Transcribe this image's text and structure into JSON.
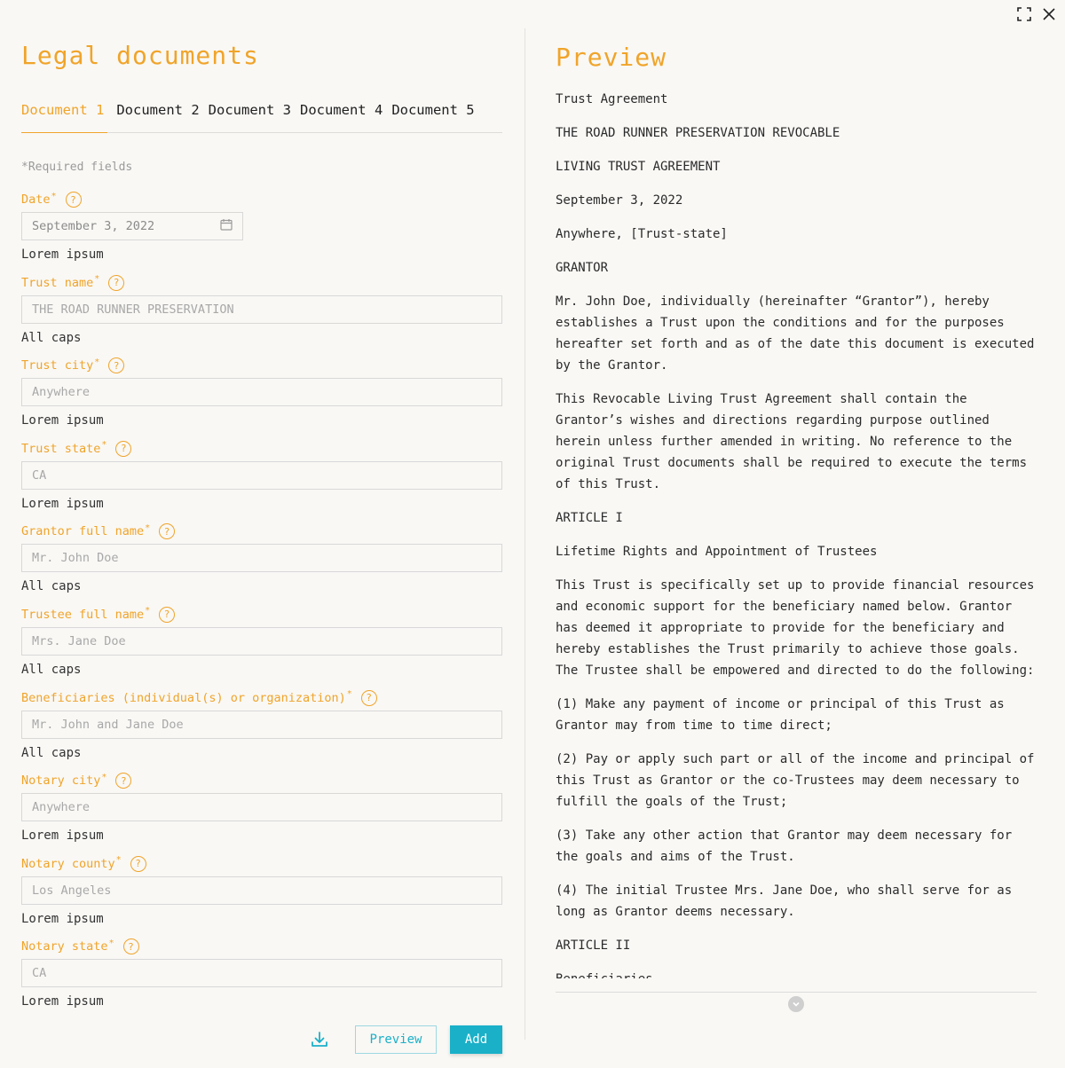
{
  "left": {
    "title": "Legal documents",
    "tabs": [
      {
        "label": "Document 1"
      },
      {
        "label": "Document 2"
      },
      {
        "label": "Document 3"
      },
      {
        "label": "Document 4"
      },
      {
        "label": "Document 5"
      }
    ],
    "required_note": "*Required fields",
    "fields": [
      {
        "label": "Date",
        "value": "September 3, 2022",
        "hint": "Lorem ipsum"
      },
      {
        "label": "Trust name",
        "placeholder": "THE ROAD RUNNER PRESERVATION",
        "hint": "All caps"
      },
      {
        "label": "Trust city",
        "placeholder": "Anywhere",
        "hint": "Lorem ipsum"
      },
      {
        "label": "Trust state",
        "placeholder": "CA",
        "hint": "Lorem ipsum"
      },
      {
        "label": "Grantor full name",
        "placeholder": "Mr. John Doe",
        "hint": "All caps"
      },
      {
        "label": "Trustee full name",
        "placeholder": "Mrs. Jane Doe",
        "hint": "All caps"
      },
      {
        "label": "Beneficiaries (individual(s) or organization)",
        "placeholder": "Mr. John and Jane Doe",
        "hint": "All caps"
      },
      {
        "label": "Notary city",
        "placeholder": "Anywhere",
        "hint": "Lorem ipsum"
      },
      {
        "label": "Notary county",
        "placeholder": "Los Angeles",
        "hint": "Lorem ipsum"
      },
      {
        "label": "Notary state",
        "placeholder": "CA",
        "hint": "Lorem ipsum"
      }
    ],
    "actions": {
      "preview_label": "Preview",
      "add_label": "Add"
    }
  },
  "right": {
    "title": "Preview",
    "paragraphs": [
      "Trust Agreement",
      "THE ROAD RUNNER PRESERVATION REVOCABLE",
      "LIVING TRUST AGREEMENT",
      "September 3, 2022",
      "Anywhere, [Trust-state]",
      "GRANTOR",
      "Mr. John Doe, individually (hereinafter “Grantor”), hereby establishes a Trust upon the conditions and for the purposes hereafter set forth and as of the date this document is executed by the Grantor.",
      "This Revocable Living Trust Agreement shall contain the Grantor’s wishes and directions regarding purpose outlined herein unless further amended in writing. No reference to the original Trust documents shall be required to execute the terms of this Trust.",
      "ARTICLE I",
      "Lifetime Rights and Appointment of Trustees",
      "This Trust is specifically set up to provide financial resources and economic support for the beneficiary named below. Grantor has deemed it appropriate to provide for the beneficiary and hereby establishes the Trust primarily to achieve those goals. The Trustee shall be empowered and directed to do the following:",
      "(1) Make any payment of income or principal of this Trust as Grantor may from time to time direct;",
      "(2) Pay or apply such part or all of the income and principal of this Trust as Grantor or the co-Trustees may deem necessary to fulfill the goals of the Trust;",
      "(3) Take any other action that Grantor may deem necessary for the goals and aims of the Trust.",
      "(4) The initial Trustee Mrs. Jane Doe, who shall serve for as long as Grantor deems necessary.",
      "ARTICLE II",
      "Beneficiaries"
    ]
  },
  "colors": {
    "accent": "#f0a42a",
    "primary": "#1ab0c8",
    "background": "#f9f8f5"
  }
}
